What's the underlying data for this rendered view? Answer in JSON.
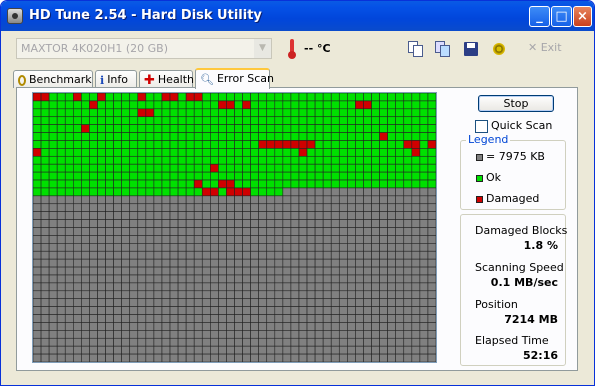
{
  "window": {
    "title": "HD Tune 2.54 - Hard Disk Utility"
  },
  "toolbar": {
    "drive": "MAXTOR 4K020H1 (20 GB)",
    "temperature": "-- °C",
    "exit_label": "Exit"
  },
  "tabs": [
    {
      "label": "Benchmark",
      "icon": "stopwatch-icon"
    },
    {
      "label": "Info",
      "icon": "info-icon"
    },
    {
      "label": "Health",
      "icon": "health-cross-icon"
    },
    {
      "label": "Error Scan",
      "icon": "magnifier-icon",
      "active": true
    }
  ],
  "scan": {
    "stop_label": "Stop",
    "quick_scan_label": "Quick Scan",
    "quick_scan_checked": false,
    "legend_title": "Legend",
    "legend": [
      {
        "label": "= 7975 KB",
        "color": "#808080"
      },
      {
        "label": "Ok",
        "color": "#00E000"
      },
      {
        "label": "Damaged",
        "color": "#D00000"
      }
    ],
    "stats": {
      "damaged_blocks_label": "Damaged Blocks",
      "damaged_blocks": "1.8 %",
      "scanning_speed_label": "Scanning Speed",
      "scanning_speed": "0.1 MB/sec",
      "position_label": "Position",
      "position": "7214 MB",
      "elapsed_label": "Elapsed Time",
      "elapsed": "52:16"
    }
  },
  "block_map": {
    "columns": 50,
    "rows": 34,
    "scanned_full_rows": 12,
    "scanned_blocks_last_row": 31,
    "colors": {
      "ok": "#00E000",
      "damaged": "#D00000",
      "unscanned": "#808080",
      "gridline": "#222222"
    },
    "damaged_blocks": [
      [
        0,
        0
      ],
      [
        0,
        1
      ],
      [
        0,
        5
      ],
      [
        0,
        8
      ],
      [
        0,
        13
      ],
      [
        0,
        16
      ],
      [
        0,
        17
      ],
      [
        0,
        19
      ],
      [
        0,
        20
      ],
      [
        1,
        7
      ],
      [
        1,
        23
      ],
      [
        1,
        24
      ],
      [
        1,
        26
      ],
      [
        1,
        40
      ],
      [
        1,
        41
      ],
      [
        2,
        13
      ],
      [
        2,
        14
      ],
      [
        4,
        6
      ],
      [
        5,
        43
      ],
      [
        6,
        28
      ],
      [
        6,
        29
      ],
      [
        6,
        30
      ],
      [
        6,
        31
      ],
      [
        6,
        32
      ],
      [
        6,
        33
      ],
      [
        6,
        34
      ],
      [
        6,
        46
      ],
      [
        6,
        47
      ],
      [
        6,
        49
      ],
      [
        7,
        0
      ],
      [
        7,
        33
      ],
      [
        7,
        47
      ],
      [
        9,
        22
      ],
      [
        11,
        20
      ],
      [
        11,
        23
      ],
      [
        11,
        24
      ],
      [
        12,
        21
      ],
      [
        12,
        22
      ],
      [
        12,
        24
      ],
      [
        12,
        25
      ],
      [
        12,
        26
      ]
    ]
  }
}
